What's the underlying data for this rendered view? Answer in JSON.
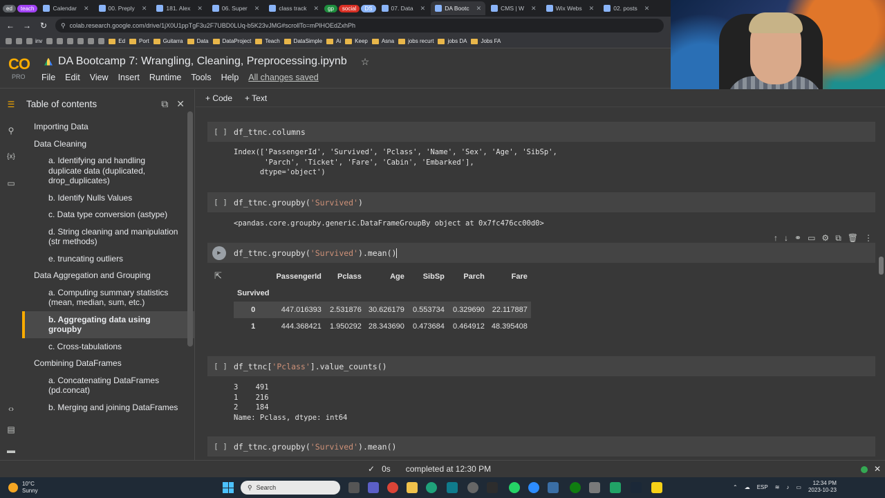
{
  "browser": {
    "tabs": [
      {
        "label": "ed",
        "type": "pill",
        "color": "#5f6368"
      },
      {
        "label": "teach",
        "type": "pill",
        "color": "#a142f4"
      },
      {
        "label": "Calendar",
        "type": "tab"
      },
      {
        "label": "00. Preply",
        "type": "tab"
      },
      {
        "label": "181. Alex",
        "type": "tab"
      },
      {
        "label": "06. Super",
        "type": "tab"
      },
      {
        "label": "class track",
        "type": "tab"
      },
      {
        "label": "gp",
        "type": "pill",
        "color": "#1e8e3e"
      },
      {
        "label": "social",
        "type": "pill",
        "color": "#d93025"
      },
      {
        "label": "DS",
        "type": "pill",
        "color": "#8ab4f8"
      },
      {
        "label": "07. Data",
        "type": "tab"
      },
      {
        "label": "DA Bootc",
        "type": "tab",
        "active": true
      },
      {
        "label": "CMS | W",
        "type": "tab"
      },
      {
        "label": "Wix Webs",
        "type": "tab"
      },
      {
        "label": "02. posts",
        "type": "tab"
      }
    ],
    "url": "colab.research.google.com/drive/1jX0U1ppTgF3u2F7UBD0LUq-b5K23vJMG#scrollTo=mPlHOEdZxhPh",
    "bookmarks": [
      "",
      "",
      "inv",
      "",
      "",
      "",
      "",
      "",
      "",
      "Ed",
      "Port",
      "Guitarra",
      "Data",
      "DataProject",
      "Teach",
      "DataSimple",
      "Ai",
      "Keep",
      "Asna",
      "jobs recurt",
      "jobs DA",
      "Jobs FA"
    ]
  },
  "colab": {
    "logo_text": "CO",
    "plan": "PRO",
    "title": "DA Bootcamp 7: Wrangling, Cleaning, Preprocessing.ipynb",
    "menu": [
      "File",
      "Edit",
      "View",
      "Insert",
      "Runtime",
      "Tools",
      "Help"
    ],
    "saved_status": "All changes saved",
    "toolbar": {
      "add_code": "+ Code",
      "add_text": "+ Text"
    }
  },
  "toc": {
    "title": "Table of contents",
    "items": [
      {
        "label": "Importing Data",
        "level": 1
      },
      {
        "label": "Data Cleaning",
        "level": 1
      },
      {
        "label": "a. Identifying and handling duplicate data (duplicated, drop_duplicates)",
        "level": 2
      },
      {
        "label": "b. Identify Nulls Values",
        "level": 2
      },
      {
        "label": "c. Data type conversion (astype)",
        "level": 2
      },
      {
        "label": "d. String cleaning and manipulation (str methods)",
        "level": 2
      },
      {
        "label": "e. truncating outliers",
        "level": 2
      },
      {
        "label": "Data Aggregation and Grouping",
        "level": 1
      },
      {
        "label": "a. Computing summary statistics (mean, median, sum, etc.)",
        "level": 2
      },
      {
        "label": "b. Aggregating data using groupby",
        "level": 2,
        "selected": true
      },
      {
        "label": "c. Cross-tabulations",
        "level": 2
      },
      {
        "label": "Combining DataFrames",
        "level": 1
      },
      {
        "label": "a. Concatenating DataFrames (pd.concat)",
        "level": 2
      },
      {
        "label": "b. Merging and joining DataFrames",
        "level": 2
      }
    ]
  },
  "cells": {
    "c1": {
      "gutter": "[ ]",
      "code": "df_ttnc.columns",
      "output": "Index(['PassengerId', 'Survived', 'Pclass', 'Name', 'Sex', 'Age', 'SibSp',\n       'Parch', 'Ticket', 'Fare', 'Cabin', 'Embarked'],\n      dtype='object')"
    },
    "c2": {
      "gutter": "[ ]",
      "code_pre": "df_ttnc.groupby(",
      "code_str": "'Survived'",
      "code_post": ")",
      "output": "<pandas.core.groupby.generic.DataFrameGroupBy object at 0x7fc476cc00d0>"
    },
    "c3": {
      "code_pre": "df_ttnc.groupby(",
      "code_str": "'Survived'",
      "code_post": ").mean()",
      "table": {
        "columns": [
          "PassengerId",
          "Pclass",
          "Age",
          "SibSp",
          "Parch",
          "Fare"
        ],
        "index_name": "Survived",
        "rows": [
          {
            "index": "0",
            "values": [
              "447.016393",
              "2.531876",
              "30.626179",
              "0.553734",
              "0.329690",
              "22.117887"
            ]
          },
          {
            "index": "1",
            "values": [
              "444.368421",
              "1.950292",
              "28.343690",
              "0.473684",
              "0.464912",
              "48.395408"
            ]
          }
        ]
      }
    },
    "c4": {
      "gutter": "[ ]",
      "code_pre": "df_ttnc[",
      "code_str": "'Pclass'",
      "code_post": "].value_counts()",
      "output": "3    491\n1    216\n2    184\nName: Pclass, dtype: int64"
    },
    "c5": {
      "gutter": "[ ]",
      "code_pre": "df_ttnc.groupby(",
      "code_str": "'Survived'",
      "code_post": ").mean()"
    }
  },
  "status": {
    "check": "✓",
    "time": "0s",
    "message": "completed at 12:30 PM"
  },
  "taskbar": {
    "temp": "10°C",
    "weather": "Sunny",
    "search_placeholder": "Search",
    "lang": "ESP",
    "time": "12:34 PM",
    "date": "2023-10-23"
  }
}
